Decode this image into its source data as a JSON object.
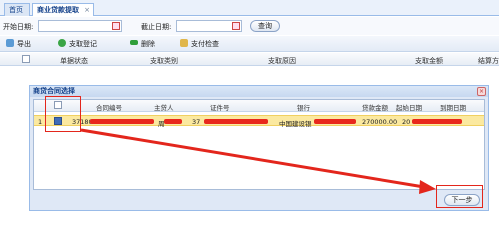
{
  "tabs": [
    {
      "label": "首页"
    },
    {
      "label": "商业贷款提取",
      "close": "×"
    }
  ],
  "search": {
    "start_label": "开始日期:",
    "end_label": "截止日期:",
    "query_label": "查询"
  },
  "toolbar": {
    "export_label": "导出",
    "register_label": "支取登记",
    "delete_label": "删除",
    "verify_label": "支付检查"
  },
  "grid": {
    "columns": [
      "单据状态",
      "支取类别",
      "支取原因",
      "支取金额",
      "结算方"
    ]
  },
  "dialog": {
    "title": "商贷合同选择",
    "close": "×",
    "columns": [
      "合同编号",
      "主贷人",
      "证件号",
      "银行",
      "贷款金额",
      "起始日期",
      "到期日期"
    ],
    "row": {
      "index": "1",
      "contract_no": "37180",
      "borrower": "周",
      "id_no": "37",
      "bank": "中国建设银",
      "amount": "270000.00",
      "start_date": "20"
    },
    "next_label": "下一步"
  },
  "colors": {
    "annotation": "#e3261c",
    "selected_row": "#fbe9a0",
    "tab_text": "#15428b"
  }
}
